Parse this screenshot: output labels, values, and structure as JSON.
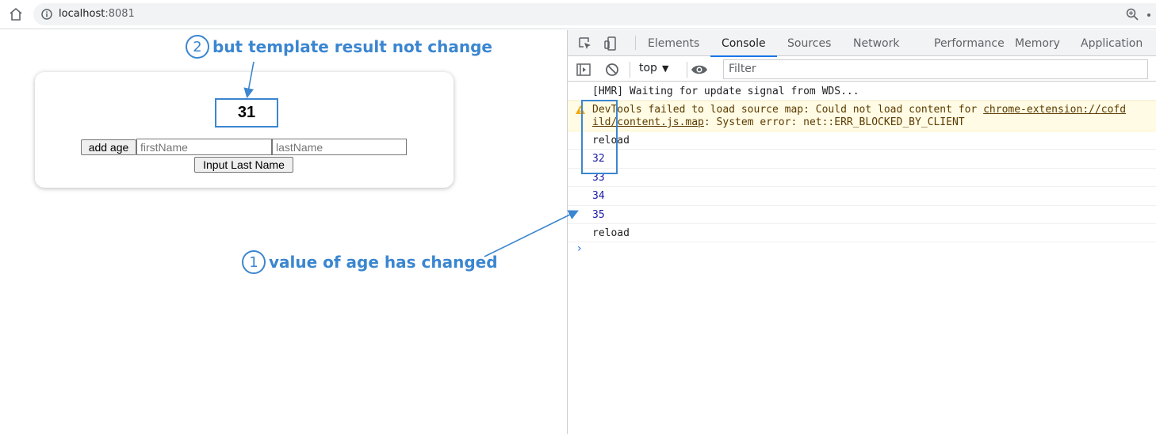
{
  "browser": {
    "url_host": "localhost",
    "url_port": ":8081"
  },
  "app": {
    "age_value": "31",
    "add_age_label": "add age",
    "first_name_placeholder": "firstName",
    "last_name_placeholder": "lastName",
    "input_last_name_label": "Input Last Name"
  },
  "annotations": {
    "a1_num": "1",
    "a1_text": "value of age has changed",
    "a2_num": "2",
    "a2_text": "but template result not change"
  },
  "devtools": {
    "tabs": [
      "Elements",
      "Console",
      "Sources",
      "Network",
      "Performance",
      "Memory",
      "Application"
    ],
    "active_tab": "Console",
    "context": "top",
    "filter_placeholder": "Filter",
    "console": {
      "hmr": "[HMR] Waiting for update signal from WDS...",
      "warn_part1": "DevTools failed to load source map: Could not load content for ",
      "warn_link1": "chrome-extension://cofd",
      "warn_link2": "ild/content.js.map",
      "warn_part2": ": System error: net::ERR_BLOCKED_BY_CLIENT",
      "reload1": "reload",
      "values": [
        "32",
        "33",
        "34",
        "35"
      ],
      "reload2": "reload"
    }
  },
  "colors": {
    "annotation_blue": "#3b86d0",
    "tab_active_underline": "#1a73e8",
    "console_number": "#1a1aa6",
    "warn_bg": "#fffbe5"
  }
}
